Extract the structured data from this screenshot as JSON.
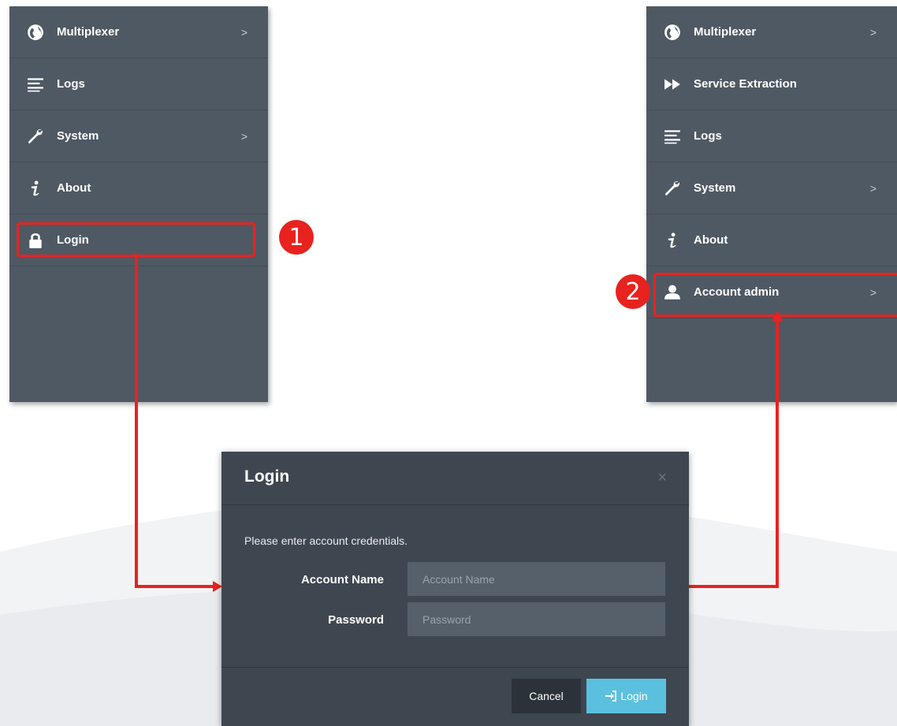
{
  "left_menu": {
    "items": [
      {
        "label": "Multiplexer",
        "icon": "globe-icon",
        "has_submenu": true,
        "chevron": ">"
      },
      {
        "label": "Logs",
        "icon": "list-icon",
        "has_submenu": false
      },
      {
        "label": "System",
        "icon": "wrench-icon",
        "has_submenu": true,
        "chevron": ">"
      },
      {
        "label": "About",
        "icon": "info-icon",
        "has_submenu": false
      },
      {
        "label": "Login",
        "icon": "lock-icon",
        "has_submenu": false
      }
    ]
  },
  "right_menu": {
    "items": [
      {
        "label": "Multiplexer",
        "icon": "globe-icon",
        "has_submenu": true,
        "chevron": ">"
      },
      {
        "label": "Service Extraction",
        "icon": "fast-forward-icon",
        "has_submenu": false
      },
      {
        "label": "Logs",
        "icon": "list-icon",
        "has_submenu": false
      },
      {
        "label": "System",
        "icon": "wrench-icon",
        "has_submenu": true,
        "chevron": ">"
      },
      {
        "label": "About",
        "icon": "info-icon",
        "has_submenu": false
      },
      {
        "label": "Account admin",
        "icon": "user-icon",
        "has_submenu": true,
        "chevron": ">"
      }
    ]
  },
  "steps": {
    "step1": "1",
    "step2": "2"
  },
  "dialog": {
    "title": "Login",
    "close": "×",
    "instruction": "Please enter account credentials.",
    "account_name_label": "Account Name",
    "account_name_placeholder": "Account Name",
    "account_name_value": "",
    "password_label": "Password",
    "password_placeholder": "Password",
    "password_value": "",
    "cancel_label": "Cancel",
    "login_label": "Login"
  },
  "colors": {
    "menu_bg": "#4f5964",
    "dialog_bg": "#3e4650",
    "highlight": "#e8231f",
    "login_button": "#5bc0de"
  }
}
